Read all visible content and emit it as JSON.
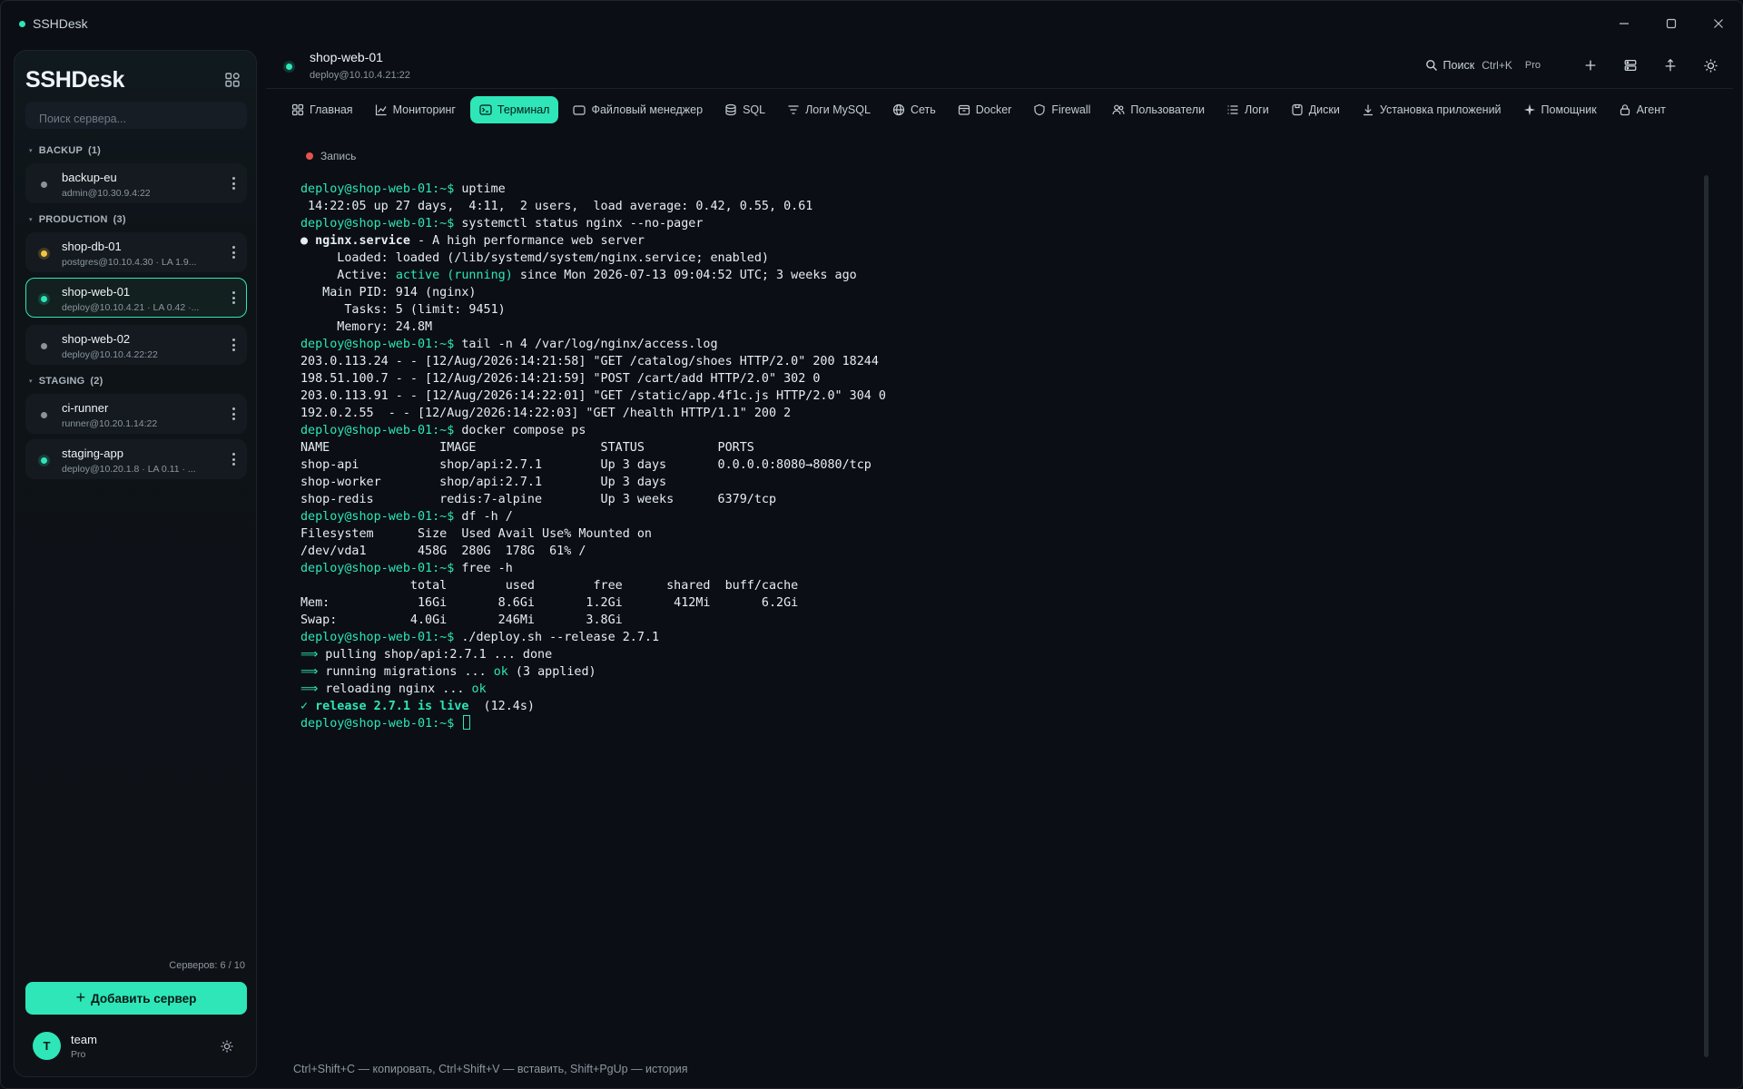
{
  "window": {
    "title": "SSHDesk"
  },
  "sidebar": {
    "brand": "SSHDesk",
    "search_placeholder": "Поиск сервера...",
    "groups": [
      {
        "name": "BACKUP",
        "count": "(1)"
      },
      {
        "name": "PRODUCTION",
        "count": "(3)"
      },
      {
        "name": "STAGING",
        "count": "(2)"
      }
    ],
    "servers": [
      {
        "name": "backup-eu",
        "sub": "admin@10.30.9.4:22",
        "status": "gray"
      },
      {
        "name": "shop-db-01",
        "sub": "postgres@10.10.4.30  ·  LA 1.9...",
        "status": "yellow"
      },
      {
        "name": "shop-web-01",
        "sub": "deploy@10.10.4.21  ·  LA 0.42 ·...",
        "status": "green"
      },
      {
        "name": "shop-web-02",
        "sub": "deploy@10.10.4.22:22",
        "status": "gray"
      },
      {
        "name": "ci-runner",
        "sub": "runner@10.20.1.14:22",
        "status": "gray"
      },
      {
        "name": "staging-app",
        "sub": "deploy@10.20.1.8  ·  LA 0.11 · ...",
        "status": "green"
      }
    ],
    "server_count": "Серверов: 6 / 10",
    "add_button": "Добавить сервер",
    "user": {
      "initial": "T",
      "name": "team",
      "plan": "Pro"
    }
  },
  "header": {
    "server_name": "shop-web-01",
    "server_sub": "deploy@10.10.4.21:22",
    "search_label": "Поиск",
    "search_shortcut": "Ctrl+K",
    "plan_tag": "Pro"
  },
  "tabs": [
    {
      "label": "Главная",
      "icon": "dashboard-icon"
    },
    {
      "label": "Мониторинг",
      "icon": "chart-icon"
    },
    {
      "label": "Терминал",
      "icon": "terminal-icon",
      "active": true
    },
    {
      "label": "Файловый менеджер",
      "icon": "folder-icon"
    },
    {
      "label": "SQL",
      "icon": "database-icon"
    },
    {
      "label": "Логи MySQL",
      "icon": "filter-icon"
    },
    {
      "label": "Сеть",
      "icon": "globe-icon"
    },
    {
      "label": "Docker",
      "icon": "box-icon"
    },
    {
      "label": "Firewall",
      "icon": "shield-icon"
    },
    {
      "label": "Пользователи",
      "icon": "users-icon"
    },
    {
      "label": "Логи",
      "icon": "list-icon"
    },
    {
      "label": "Диски",
      "icon": "disk-icon"
    },
    {
      "label": "Установка приложений",
      "icon": "download-icon"
    },
    {
      "label": "Помощник",
      "icon": "sparkle-icon"
    },
    {
      "label": "Агент",
      "icon": "lock-icon"
    }
  ],
  "terminal": {
    "record_label": "Запись",
    "prompt": "deploy@shop-web-01:~$",
    "lines": [
      {
        "p": true,
        "t": " uptime"
      },
      {
        "t": " 14:22:05 up 27 days,  4:11,  2 users,  load average: 0.42, 0.55, 0.61"
      },
      {
        "p": true,
        "t": " systemctl status nginx --no-pager"
      },
      {
        "svc": true,
        "a": "● ",
        "b": "nginx.service",
        "c": " - A high performance web server"
      },
      {
        "t": "     Loaded: loaded (/lib/systemd/system/nginx.service; enabled)"
      },
      {
        "act": true,
        "a": "     Active: ",
        "b": "active (running)",
        "c": " since Mon 2026-07-13 09:04:52 UTC; 3 weeks ago"
      },
      {
        "t": "   Main PID: 914 (nginx)"
      },
      {
        "t": "      Tasks: 5 (limit: 9451)"
      },
      {
        "t": "     Memory: 24.8M"
      },
      {
        "p": true,
        "t": " tail -n 4 /var/log/nginx/access.log"
      },
      {
        "t": "203.0.113.24 - - [12/Aug/2026:14:21:58] \"GET /catalog/shoes HTTP/2.0\" 200 18244"
      },
      {
        "t": "198.51.100.7 - - [12/Aug/2026:14:21:59] \"POST /cart/add HTTP/2.0\" 302 0"
      },
      {
        "t": "203.0.113.91 - - [12/Aug/2026:14:22:01] \"GET /static/app.4f1c.js HTTP/2.0\" 304 0"
      },
      {
        "t": "192.0.2.55  - - [12/Aug/2026:14:22:03] \"GET /health HTTP/1.1\" 200 2"
      },
      {
        "p": true,
        "t": " docker compose ps"
      },
      {
        "t": "NAME               IMAGE                 STATUS          PORTS"
      },
      {
        "t": "shop-api           shop/api:2.7.1        Up 3 days       0.0.0.0:8080→8080/tcp"
      },
      {
        "t": "shop-worker        shop/api:2.7.1        Up 3 days"
      },
      {
        "t": "shop-redis         redis:7-alpine        Up 3 weeks      6379/tcp"
      },
      {
        "p": true,
        "t": " df -h /"
      },
      {
        "t": "Filesystem      Size  Used Avail Use% Mounted on"
      },
      {
        "t": "/dev/vda1       458G  280G  178G  61% /"
      },
      {
        "p": true,
        "t": " free -h"
      },
      {
        "t": "               total        used        free      shared  buff/cache"
      },
      {
        "t": "Mem:            16Gi       8.6Gi       1.2Gi       412Mi       6.2Gi"
      },
      {
        "t": "Swap:          4.0Gi       246Mi       3.8Gi"
      },
      {
        "p": true,
        "t": " ./deploy.sh --release 2.7.1"
      },
      {
        "arrow": true,
        "a": "⟹ ",
        "b": "pulling shop/api:2.7.1 ... done"
      },
      {
        "arrow": true,
        "a": "⟹ ",
        "b": "running migrations ... ",
        "c": "ok",
        "d": " (3 applied)"
      },
      {
        "arrow": true,
        "a": "⟹ ",
        "b": "reloading nginx ... ",
        "c": "ok"
      },
      {
        "done": true,
        "a": "✓ release 2.7.1 is live",
        "b": "  (12.4s)"
      },
      {
        "p": true,
        "t": " ",
        "cursor": true
      }
    ]
  },
  "footer_hint": "Ctrl+Shift+C — копировать, Ctrl+Shift+V — вставить, Shift+PgUp — история",
  "colors": {
    "accent": "#2ee6b8",
    "background": "#0b0f15",
    "record": "#e5534b",
    "warning": "#f5c542"
  }
}
